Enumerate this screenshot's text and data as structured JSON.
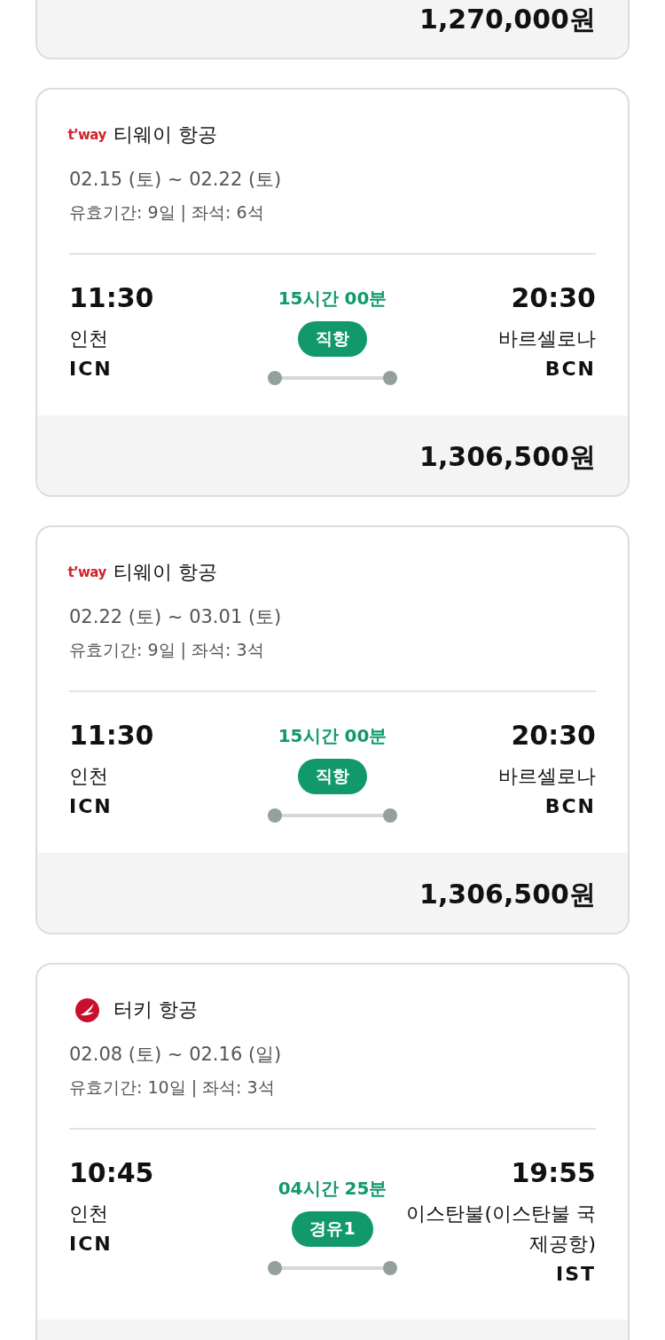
{
  "cards": [
    {
      "kind": "clipped",
      "price": "1,270,000원"
    },
    {
      "kind": "full",
      "airline": {
        "logo": {
          "kind": "wordmark",
          "text": "t’way"
        },
        "name": "티웨이 항공"
      },
      "dates": "02.15 (토) ~ 02.22 (토)",
      "validity": "유효기간: 9일 | 좌석: 6석",
      "departure": {
        "time": "11:30",
        "city": "인천",
        "code": "ICN"
      },
      "duration": "15시간 00분",
      "stops": "직항",
      "arrival": {
        "time": "20:30",
        "city": "바르셀로나",
        "code": "BCN"
      },
      "price": "1,306,500원"
    },
    {
      "kind": "full",
      "airline": {
        "logo": {
          "kind": "wordmark",
          "text": "t’way"
        },
        "name": "티웨이 항공"
      },
      "dates": "02.22 (토) ~ 03.01 (토)",
      "validity": "유효기간: 9일 | 좌석: 3석",
      "departure": {
        "time": "11:30",
        "city": "인천",
        "code": "ICN"
      },
      "duration": "15시간 00분",
      "stops": "직항",
      "arrival": {
        "time": "20:30",
        "city": "바르셀로나",
        "code": "BCN"
      },
      "price": "1,306,500원"
    },
    {
      "kind": "full",
      "airline": {
        "logo": {
          "kind": "emblem"
        },
        "name": "터키 항공"
      },
      "dates": "02.08 (토) ~ 02.16 (일)",
      "validity": "유효기간: 10일 | 좌석: 3석",
      "departure": {
        "time": "10:45",
        "city": "인천",
        "code": "ICN"
      },
      "duration": "04시간 25분",
      "stops": "경유1",
      "arrival": {
        "time": "19:55",
        "city": "이스탄불(이스탄불 국제공항)",
        "code": "IST"
      }
    }
  ]
}
